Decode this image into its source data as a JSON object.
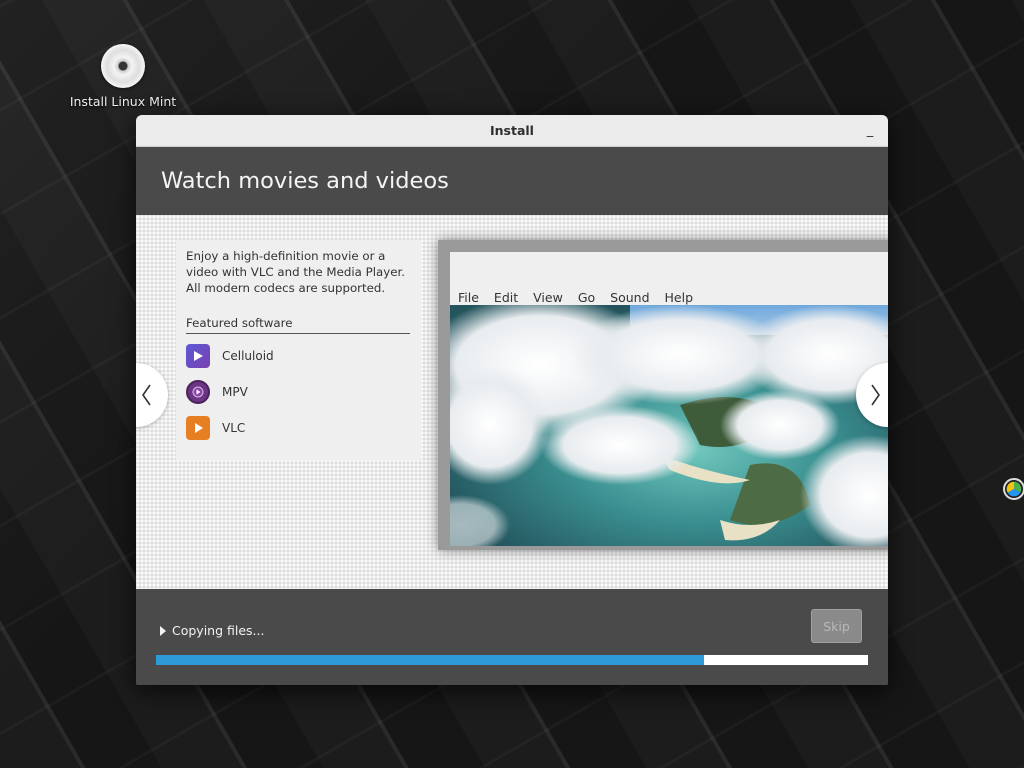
{
  "desktop": {
    "icon_label": "Install Linux Mint"
  },
  "window": {
    "title": "Install"
  },
  "slide": {
    "title": "Watch movies and videos",
    "description": "Enjoy a high-definition movie or a video with VLC and the Media Player. All modern codecs are supported.",
    "featured_heading": "Featured software",
    "software": [
      {
        "name": "Celluloid",
        "icon": "celluloid-icon"
      },
      {
        "name": "MPV",
        "icon": "mpv-icon"
      },
      {
        "name": "VLC",
        "icon": "vlc-icon"
      }
    ],
    "player_menu": [
      "File",
      "Edit",
      "View",
      "Go",
      "Sound",
      "Help"
    ]
  },
  "footer": {
    "status": "Copying files...",
    "skip_label": "Skip",
    "skip_enabled": false,
    "progress_fraction": 0.77
  },
  "colors": {
    "progress": "#2f9ad8",
    "window_bg": "#4a4a4a",
    "slide_bg": "#ececec"
  }
}
